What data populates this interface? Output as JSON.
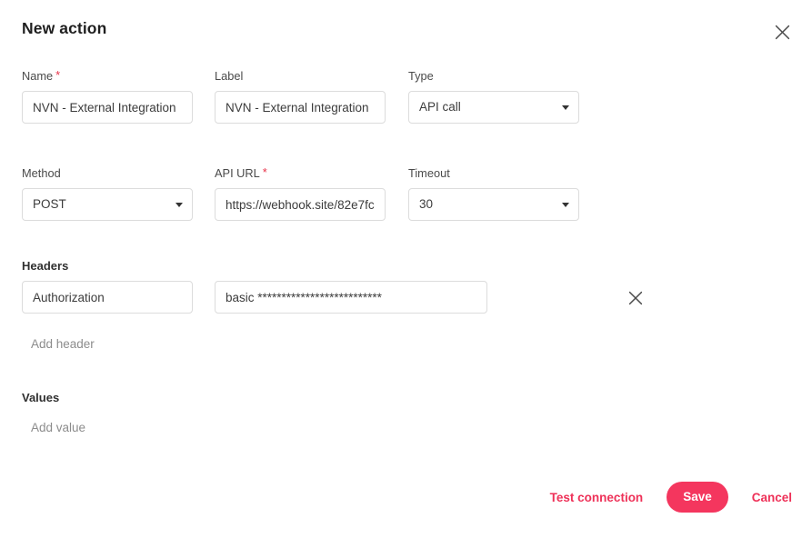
{
  "dialog": {
    "title": "New action",
    "close_icon": "close-icon"
  },
  "form": {
    "name": {
      "label": "Name",
      "required": true,
      "value": "NVN - External Integration"
    },
    "label_field": {
      "label": "Label",
      "required": false,
      "value": "NVN - External Integration"
    },
    "type": {
      "label": "Type",
      "required": false,
      "value": "API call",
      "caret_icon": "chevron-down-icon"
    },
    "method": {
      "label": "Method",
      "required": false,
      "value": "POST",
      "caret_icon": "chevron-down-icon"
    },
    "api_url": {
      "label": "API URL",
      "required": true,
      "value": "https://webhook.site/82e7fc"
    },
    "timeout": {
      "label": "Timeout",
      "required": false,
      "value": "30",
      "caret_icon": "chevron-down-icon"
    }
  },
  "headers_section": {
    "title": "Headers",
    "rows": [
      {
        "key": "Authorization",
        "value": "basic **************************",
        "remove_icon": "close-icon"
      }
    ],
    "add_label": "Add header"
  },
  "values_section": {
    "title": "Values",
    "add_label": "Add value"
  },
  "footer": {
    "test_connection_label": "Test connection",
    "save_label": "Save",
    "cancel_label": "Cancel"
  },
  "colors": {
    "accent": "#f4365e",
    "link": "#ee3158",
    "required_star": "#e8334a",
    "border": "#dcdcdc",
    "text": "#3c3c3c",
    "label": "#4a4a4a",
    "muted": "#8c8c8c"
  },
  "required_marker": "*"
}
